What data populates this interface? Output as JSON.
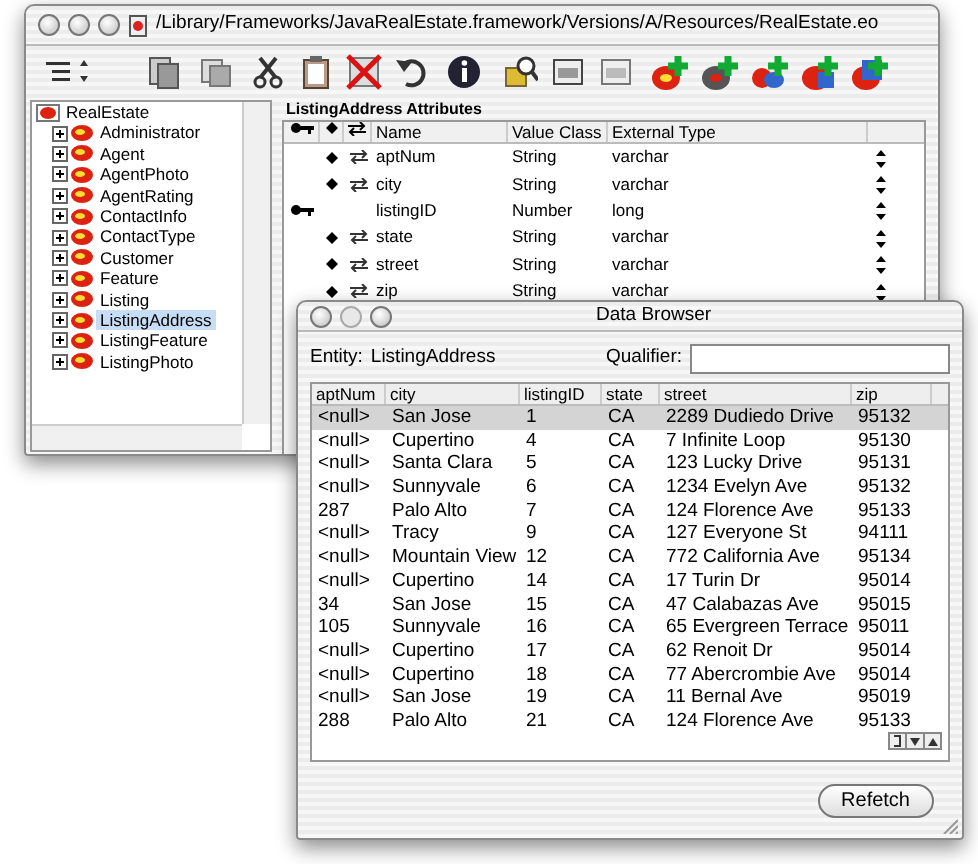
{
  "main_window": {
    "title": "/Library/Frameworks/JavaRealEstate.framework/Versions/A/Resources/RealEstate.eo",
    "tree": [
      {
        "label": "RealEstate",
        "selected": false,
        "children": [
          {
            "label": "Administrator",
            "expanded": false,
            "selected": false
          },
          {
            "label": "Agent",
            "expanded": false,
            "selected": false
          },
          {
            "label": "AgentPhoto",
            "expanded": false,
            "selected": false
          },
          {
            "label": "AgentRating",
            "expanded": false,
            "selected": false
          },
          {
            "label": "ContactInfo",
            "expanded": false,
            "selected": false
          },
          {
            "label": "ContactType",
            "expanded": false,
            "selected": false
          },
          {
            "label": "Customer",
            "expanded": false,
            "selected": false
          },
          {
            "label": "Feature",
            "expanded": false,
            "selected": false
          },
          {
            "label": "Listing",
            "expanded": false,
            "selected": false
          },
          {
            "label": "ListingAddress",
            "expanded": false,
            "selected": true
          },
          {
            "label": "ListingFeature",
            "expanded": false,
            "selected": false
          },
          {
            "label": "ListingPhoto",
            "expanded": false,
            "selected": false
          }
        ]
      }
    ],
    "attributes": {
      "title": "ListingAddress Attributes",
      "columns": [
        "Name",
        "Value Class",
        "External Type"
      ],
      "rows": [
        {
          "primary_key": false,
          "class_property": true,
          "locking": true,
          "name": "aptNum",
          "value_class": "String",
          "external_type": "varchar"
        },
        {
          "primary_key": false,
          "class_property": true,
          "locking": true,
          "name": "city",
          "value_class": "String",
          "external_type": "varchar"
        },
        {
          "primary_key": true,
          "class_property": false,
          "locking": false,
          "name": "listingID",
          "value_class": "Number",
          "external_type": "long"
        },
        {
          "primary_key": false,
          "class_property": true,
          "locking": true,
          "name": "state",
          "value_class": "String",
          "external_type": "varchar"
        },
        {
          "primary_key": false,
          "class_property": true,
          "locking": true,
          "name": "street",
          "value_class": "String",
          "external_type": "varchar"
        },
        {
          "primary_key": false,
          "class_property": true,
          "locking": true,
          "name": "zip",
          "value_class": "String",
          "external_type": "varchar"
        }
      ]
    }
  },
  "data_browser": {
    "title": "Data Browser",
    "entity_label": "Entity:",
    "entity": "ListingAddress",
    "qualifier_label": "Qualifier:",
    "columns": [
      "aptNum",
      "city",
      "listingID",
      "state",
      "street",
      "zip"
    ],
    "rows": [
      {
        "selected": true,
        "cells": [
          "<null>",
          "San Jose",
          "1",
          "CA",
          "2289 Dudiedo Drive",
          "95132"
        ]
      },
      {
        "selected": false,
        "cells": [
          "<null>",
          "Cupertino",
          "4",
          "CA",
          "7 Infinite Loop",
          "95130"
        ]
      },
      {
        "selected": false,
        "cells": [
          "<null>",
          "Santa Clara",
          "5",
          "CA",
          "123 Lucky Drive",
          "95131"
        ]
      },
      {
        "selected": false,
        "cells": [
          "<null>",
          "Sunnyvale",
          "6",
          "CA",
          "1234 Evelyn Ave",
          "95132"
        ]
      },
      {
        "selected": false,
        "cells": [
          "287",
          "Palo Alto",
          "7",
          "CA",
          "124 Florence Ave",
          "95133"
        ]
      },
      {
        "selected": false,
        "cells": [
          "<null>",
          "Tracy",
          "9",
          "CA",
          "127 Everyone St",
          "94111"
        ]
      },
      {
        "selected": false,
        "cells": [
          "<null>",
          "Mountain View",
          "12",
          "CA",
          "772 California Ave",
          "95134"
        ]
      },
      {
        "selected": false,
        "cells": [
          "<null>",
          "Cupertino",
          "14",
          "CA",
          "17 Turin Dr",
          "95014"
        ]
      },
      {
        "selected": false,
        "cells": [
          "34",
          "San Jose",
          "15",
          "CA",
          "47 Calabazas Ave",
          "95015"
        ]
      },
      {
        "selected": false,
        "cells": [
          "105",
          "Sunnyvale",
          "16",
          "CA",
          "65 Evergreen Terrace",
          "95011"
        ]
      },
      {
        "selected": false,
        "cells": [
          "<null>",
          "Cupertino",
          "17",
          "CA",
          "62 Renoit Dr",
          "95014"
        ]
      },
      {
        "selected": false,
        "cells": [
          "<null>",
          "Cupertino",
          "18",
          "CA",
          "77 Abercrombie Ave",
          "95014"
        ]
      },
      {
        "selected": false,
        "cells": [
          "<null>",
          "San Jose",
          "19",
          "CA",
          "11 Bernal Ave",
          "95019"
        ]
      },
      {
        "selected": false,
        "cells": [
          "288",
          "Palo Alto",
          "21",
          "CA",
          "124 Florence Ave",
          "95133"
        ]
      }
    ],
    "button": "Refetch"
  }
}
